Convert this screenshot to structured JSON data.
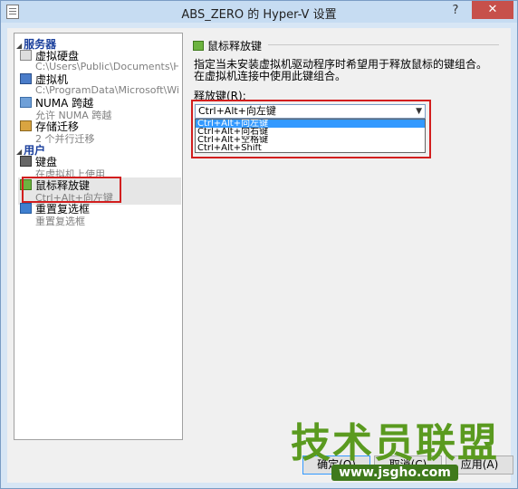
{
  "window": {
    "title": "ABS_ZERO 的 Hyper-V 设置",
    "help_glyph": "?",
    "close_glyph": "✕"
  },
  "sidebar": {
    "groups": [
      {
        "label": "服务器",
        "items": [
          {
            "name": "虚拟硬盘",
            "detail": "C:\\Users\\Public\\Documents\\Hyper-...",
            "icon": "disk-icon"
          },
          {
            "name": "虚拟机",
            "detail": "C:\\ProgramData\\Microsoft\\Windo...",
            "icon": "vm-icon"
          },
          {
            "name": "NUMA 跨越",
            "detail": "允许 NUMA 跨越",
            "icon": "numa-icon"
          },
          {
            "name": "存储迁移",
            "detail": "2 个并行迁移",
            "icon": "migration-icon"
          }
        ]
      },
      {
        "label": "用户",
        "items": [
          {
            "name": "键盘",
            "detail": "在虚拟机上使用",
            "icon": "keyboard-icon"
          },
          {
            "name": "鼠标释放键",
            "detail": "Ctrl+Alt+向左键",
            "icon": "mouse-icon",
            "selected": true
          },
          {
            "name": "重置复选框",
            "detail": "重置复选框",
            "icon": "reset-icon"
          }
        ]
      }
    ]
  },
  "main": {
    "section_title": "鼠标释放键",
    "description": "指定当未安装虚拟机驱动程序时希望用于释放鼠标的键组合。在虚拟机连接中使用此键组合。",
    "field_label": "释放键(R):",
    "combo_value": "Ctrl+Alt+向左键",
    "options": [
      "Ctrl+Alt+向左键",
      "Ctrl+Alt+向右键",
      "Ctrl+Alt+空格键",
      "Ctrl+Alt+Shift"
    ],
    "selected_option": 0
  },
  "buttons": {
    "ok": "确定(O)",
    "cancel": "取消(C)",
    "apply": "应用(A)"
  },
  "watermark": {
    "title": "技术员联盟",
    "url": "www.jsgho.com"
  }
}
